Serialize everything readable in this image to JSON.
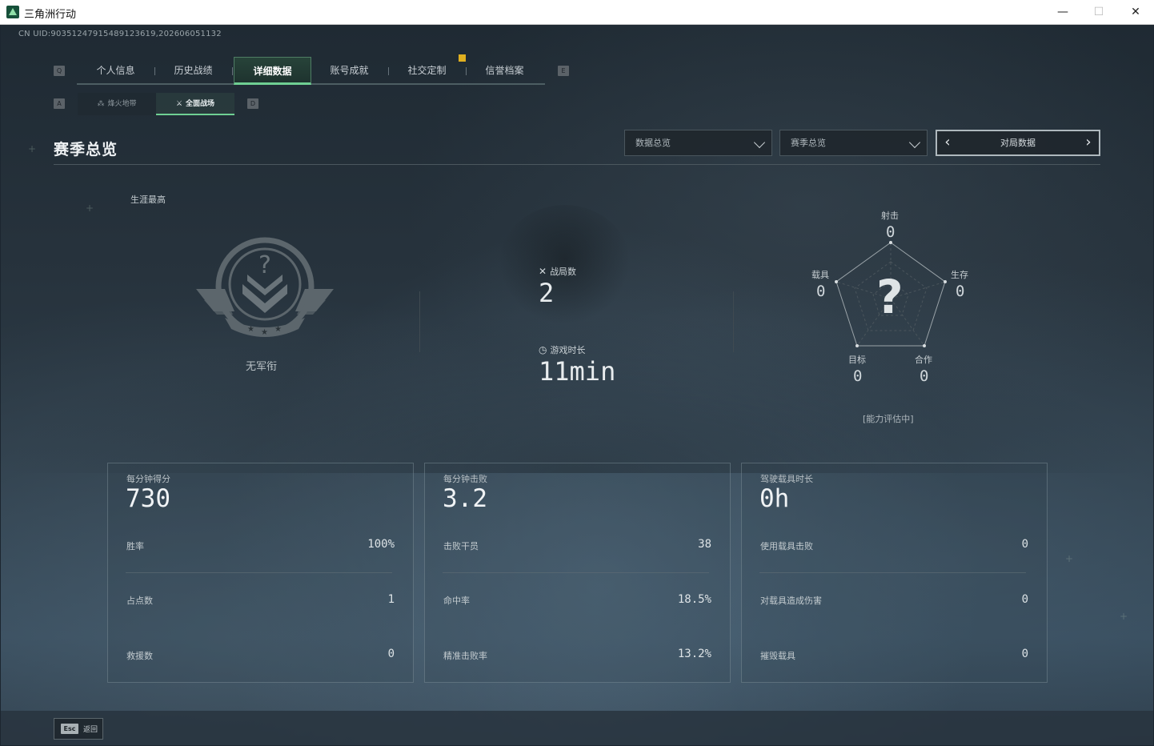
{
  "window": {
    "title": "三角洲行动",
    "minimize": "—",
    "maximize": "☐",
    "close": "✕"
  },
  "uid": "CN UID:9035124791548912361​9,2026060​51132",
  "keys": {
    "prev_tab": "Q",
    "next_tab": "E",
    "prev_sub": "A",
    "next_sub": "D"
  },
  "main_nav": {
    "tabs": [
      {
        "label": "个人信息"
      },
      {
        "label": "历史战绩"
      },
      {
        "label": "详细数据",
        "active": true
      },
      {
        "label": "账号成就"
      },
      {
        "label": "社交定制"
      },
      {
        "label": "信誉档案"
      }
    ]
  },
  "sub_nav": {
    "tabs": [
      {
        "label": "烽火地带",
        "icon": "flame-icon"
      },
      {
        "label": "全面战场",
        "icon": "battlefield-icon",
        "active": true
      }
    ]
  },
  "section": {
    "title": "赛季总览",
    "dropdown1": "数据总览",
    "dropdown2": "赛季总览",
    "pager_label": "对局数据"
  },
  "rank": {
    "label": "生涯最高",
    "name": "无军衔"
  },
  "summary": {
    "matches_label": "战局数",
    "matches_value": "2",
    "time_label": "游戏时长",
    "time_value": "11min"
  },
  "radar": {
    "center_mark": "?",
    "status": "[能力评估中]",
    "axes": [
      {
        "label": "射击",
        "value": "0"
      },
      {
        "label": "生存",
        "value": "0"
      },
      {
        "label": "合作",
        "value": "0"
      },
      {
        "label": "目标",
        "value": "0"
      },
      {
        "label": "载具",
        "value": "0"
      }
    ]
  },
  "cards": [
    {
      "title": "每分钟得分",
      "big": "730",
      "rows": [
        {
          "label": "胜率",
          "value": "100%"
        },
        {
          "label": "占点数",
          "value": "1"
        },
        {
          "label": "救援数",
          "value": "0"
        }
      ]
    },
    {
      "title": "每分钟击败",
      "big": "3.2",
      "rows": [
        {
          "label": "击败干员",
          "value": "38"
        },
        {
          "label": "命中率",
          "value": "18.5%"
        },
        {
          "label": "精准击败率",
          "value": "13.2%"
        }
      ]
    },
    {
      "title": "驾驶载具时长",
      "big": "0h",
      "rows": [
        {
          "label": "使用载具击败",
          "value": "0"
        },
        {
          "label": "对载具造成伤害",
          "value": "0"
        },
        {
          "label": "摧毁载具",
          "value": "0"
        }
      ]
    }
  ],
  "footer": {
    "esc_key": "Esc",
    "back_label": "返回"
  },
  "colors": {
    "accent": "#6fcf93",
    "badge": "#e0b020"
  }
}
